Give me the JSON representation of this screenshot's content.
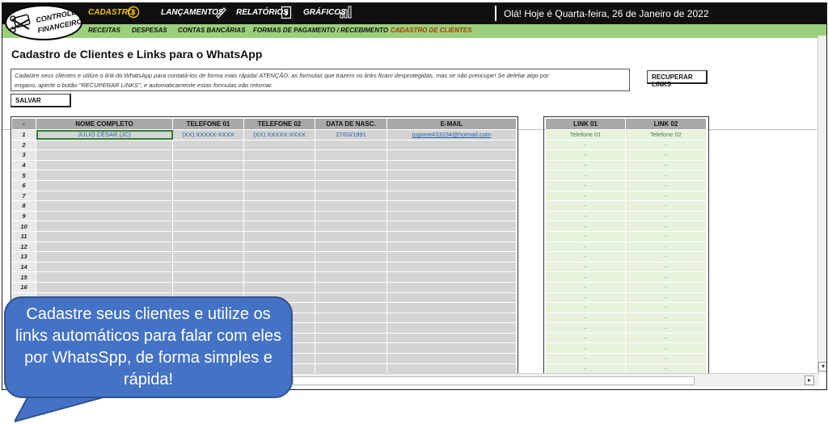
{
  "topbar": {
    "logo_line1": "CONTROLE",
    "logo_line2": "FINANCEIRO",
    "menu": [
      {
        "label": "CADASTRO",
        "icon": "dollar-coin-icon",
        "active": true
      },
      {
        "label": "LANÇAMENTOS",
        "icon": "pencil-icon",
        "active": false
      },
      {
        "label": "RELATÓRIOS",
        "icon": "dollar-document-icon",
        "active": false
      },
      {
        "label": "GRÁFICOS",
        "icon": "bar-chart-icon",
        "active": false
      }
    ],
    "greeting": "Olá! Hoje é Quarta-feira, 26 de Janeiro de 2022"
  },
  "subnav": [
    {
      "label": "RECEITAS",
      "active": false
    },
    {
      "label": "DESPESAS",
      "active": false
    },
    {
      "label": "CONTAS BANCÁRIAS",
      "active": false
    },
    {
      "label": "FORMAS DE PAGAMENTO / RECEBIMENTO",
      "active": false
    },
    {
      "label": "CADASTRO DE CLIENTES",
      "active": true
    }
  ],
  "page": {
    "title": "Cadastro de Clientes e Links para o WhatsApp",
    "info_line1": "Cadastre seus clientes e utilize o link do WhatsApp para contatá-los de forma mais rápida! ATENÇÃO: as formulas que trazem os links ficam desprotegidas, mas se não preocupe! Se deletar algo por",
    "info_line2": "engano, aperte o botão \"RECUPERAR LINKS\", e automaticamente estas formulas irão retornar.",
    "recover_button": "RECUPERAR LINKS",
    "save_button": "SALVAR"
  },
  "table": {
    "headers": [
      "-",
      "NOME COMPLETO",
      "TELEFONE 01",
      "TELEFONE 02",
      "DATA DE NASC.",
      "E-MAIL"
    ],
    "rows": [
      {
        "n": "1",
        "name": "JULIO CÉSAR (JC)",
        "tel1": "(XX) XXXXX-XXXX",
        "tel2": "(XX) XXXXX-XXXX",
        "birth": "27/03/1991",
        "email": "jcgome433234@hotmail.com"
      },
      {
        "n": "2",
        "name": "",
        "tel1": "",
        "tel2": "",
        "birth": "",
        "email": ""
      },
      {
        "n": "3",
        "name": "",
        "tel1": "",
        "tel2": "",
        "birth": "",
        "email": ""
      },
      {
        "n": "4",
        "name": "",
        "tel1": "",
        "tel2": "",
        "birth": "",
        "email": ""
      },
      {
        "n": "5",
        "name": "",
        "tel1": "",
        "tel2": "",
        "birth": "",
        "email": ""
      },
      {
        "n": "6",
        "name": "",
        "tel1": "",
        "tel2": "",
        "birth": "",
        "email": ""
      },
      {
        "n": "7",
        "name": "",
        "tel1": "",
        "tel2": "",
        "birth": "",
        "email": ""
      },
      {
        "n": "8",
        "name": "",
        "tel1": "",
        "tel2": "",
        "birth": "",
        "email": ""
      },
      {
        "n": "9",
        "name": "",
        "tel1": "",
        "tel2": "",
        "birth": "",
        "email": ""
      },
      {
        "n": "10",
        "name": "",
        "tel1": "",
        "tel2": "",
        "birth": "",
        "email": ""
      },
      {
        "n": "11",
        "name": "",
        "tel1": "",
        "tel2": "",
        "birth": "",
        "email": ""
      },
      {
        "n": "12",
        "name": "",
        "tel1": "",
        "tel2": "",
        "birth": "",
        "email": ""
      },
      {
        "n": "13",
        "name": "",
        "tel1": "",
        "tel2": "",
        "birth": "",
        "email": ""
      },
      {
        "n": "14",
        "name": "",
        "tel1": "",
        "tel2": "",
        "birth": "",
        "email": ""
      },
      {
        "n": "15",
        "name": "",
        "tel1": "",
        "tel2": "",
        "birth": "",
        "email": ""
      },
      {
        "n": "16",
        "name": "",
        "tel1": "",
        "tel2": "",
        "birth": "",
        "email": ""
      }
    ],
    "blank_rows": 8
  },
  "links": {
    "headers": [
      "LINK 01",
      "LINK 02"
    ],
    "rows": [
      [
        "Telefone 01",
        "Telefone 02"
      ],
      [
        "-",
        "-"
      ],
      [
        "-",
        "-"
      ],
      [
        "-",
        "-"
      ],
      [
        "-",
        "-"
      ],
      [
        "-",
        "-"
      ],
      [
        "-",
        "-"
      ],
      [
        "-",
        "-"
      ],
      [
        "-",
        "-"
      ],
      [
        "-",
        "-"
      ],
      [
        "-",
        "-"
      ],
      [
        "-",
        "-"
      ],
      [
        "-",
        "-"
      ],
      [
        "-",
        "-"
      ],
      [
        "-",
        "-"
      ],
      [
        "-",
        "-"
      ],
      [
        "-",
        "-"
      ],
      [
        "-",
        "-"
      ],
      [
        "-",
        "-"
      ],
      [
        "-",
        "-"
      ],
      [
        "-",
        "-"
      ],
      [
        "-",
        "-"
      ],
      [
        "-",
        "-"
      ],
      [
        "-",
        "-"
      ]
    ]
  },
  "callout": {
    "text": "Cadastre seus clientes e utilize os links automáticos para falar com eles por WhatsSpp, de forma simples e rápida!"
  },
  "colors": {
    "topbar": "#101010",
    "subbar": "#9bd07a",
    "active_menu": "#f2c200",
    "callout": "#4472c4"
  }
}
